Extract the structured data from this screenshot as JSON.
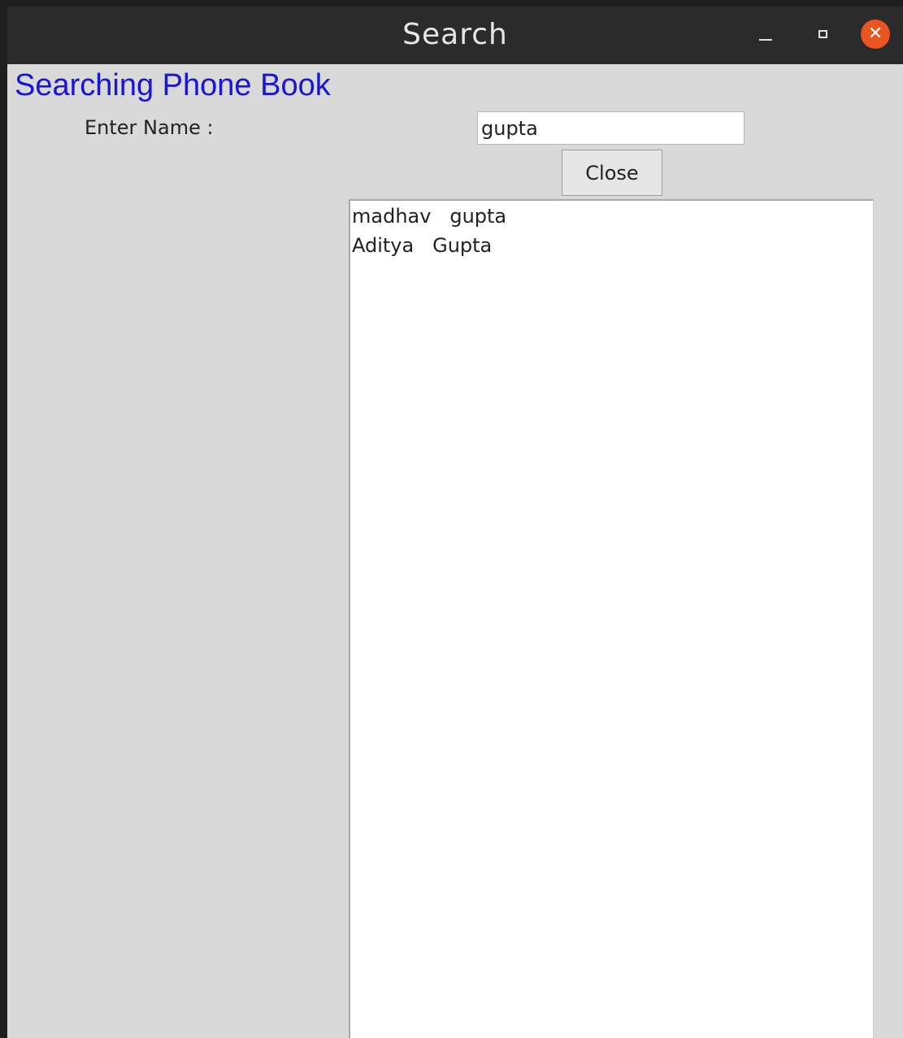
{
  "window": {
    "title": "Search",
    "controls": {
      "minimize_icon": "minimize-icon",
      "maximize_icon": "maximize-icon",
      "close_icon": "close-icon"
    },
    "accent_color": "#e95420"
  },
  "app": {
    "heading": "Searching Phone Book",
    "heading_color": "#1a14d4",
    "name_label": "Enter Name :",
    "name_value": "gupta",
    "close_label": "Close"
  },
  "results": [
    "madhav   gupta",
    "Aditya   Gupta"
  ]
}
